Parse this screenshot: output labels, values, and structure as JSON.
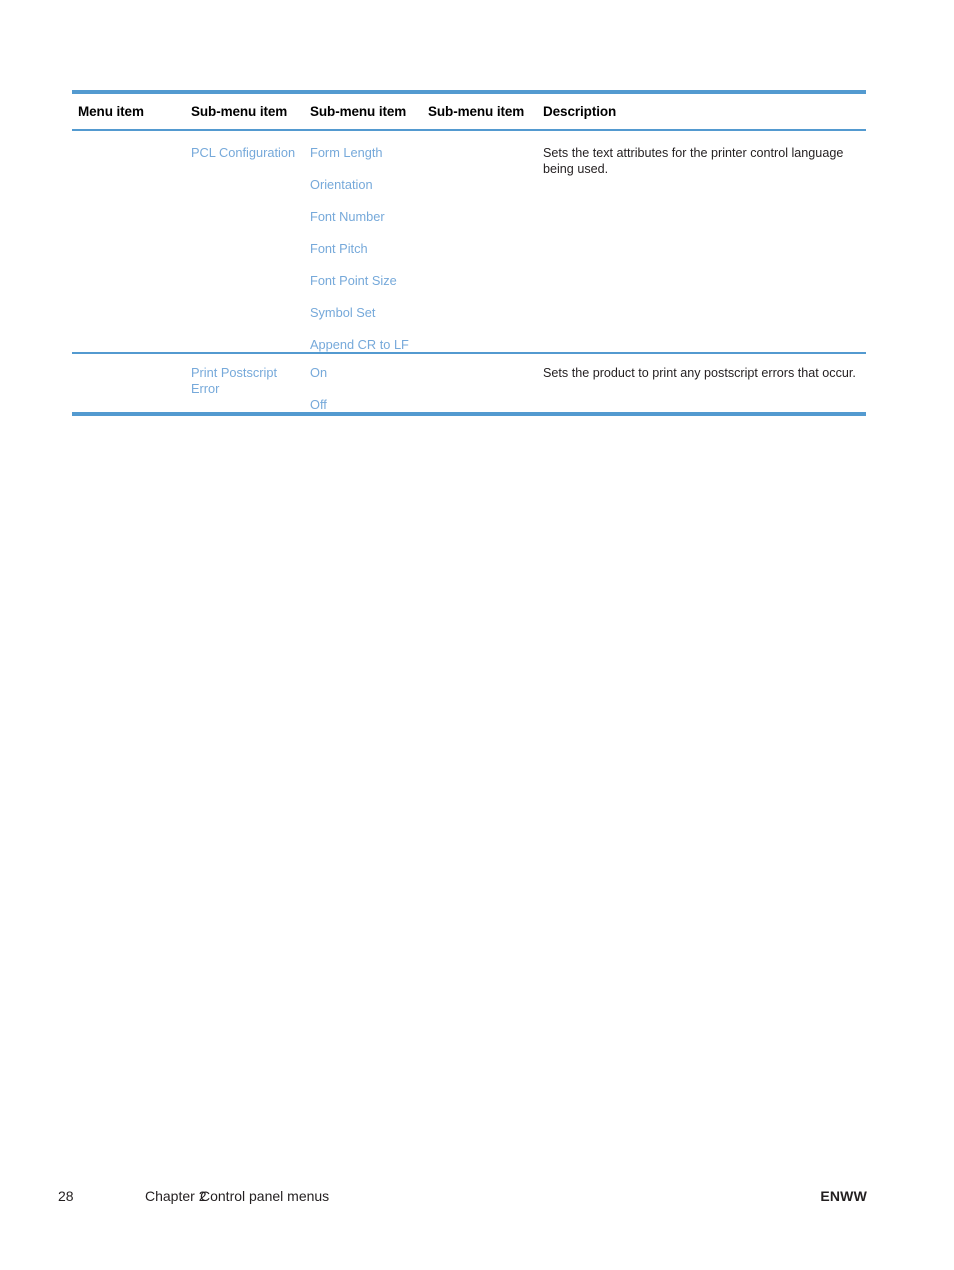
{
  "document": {
    "accent_color": "#539AD0",
    "link_color": "#76A9DA",
    "text_color": "#231F20"
  },
  "table": {
    "headers": [
      "Menu item",
      "Sub-menu item",
      "Sub-menu item",
      "Sub-menu item",
      "Description"
    ],
    "rows": [
      {
        "menu_item": "",
        "sub_menu_1": "PCL Configuration",
        "sub_menu_2_items": [
          "Form Length",
          "Orientation",
          "Font Number",
          "Font Pitch",
          "Font Point Size",
          "Symbol Set",
          "Append CR to LF"
        ],
        "sub_menu_3": "",
        "description": "Sets the text attributes for the printer control language being used."
      },
      {
        "menu_item": "",
        "sub_menu_1": "Print Postscript Error",
        "sub_menu_2_items": [
          "On",
          "Off"
        ],
        "sub_menu_3": "",
        "description": "Sets the product to print any postscript errors that occur."
      }
    ]
  },
  "footer": {
    "page_number": "28",
    "chapter": "Chapter 2",
    "chapter_title": "Control panel menus",
    "locale_code": "ENWW"
  }
}
